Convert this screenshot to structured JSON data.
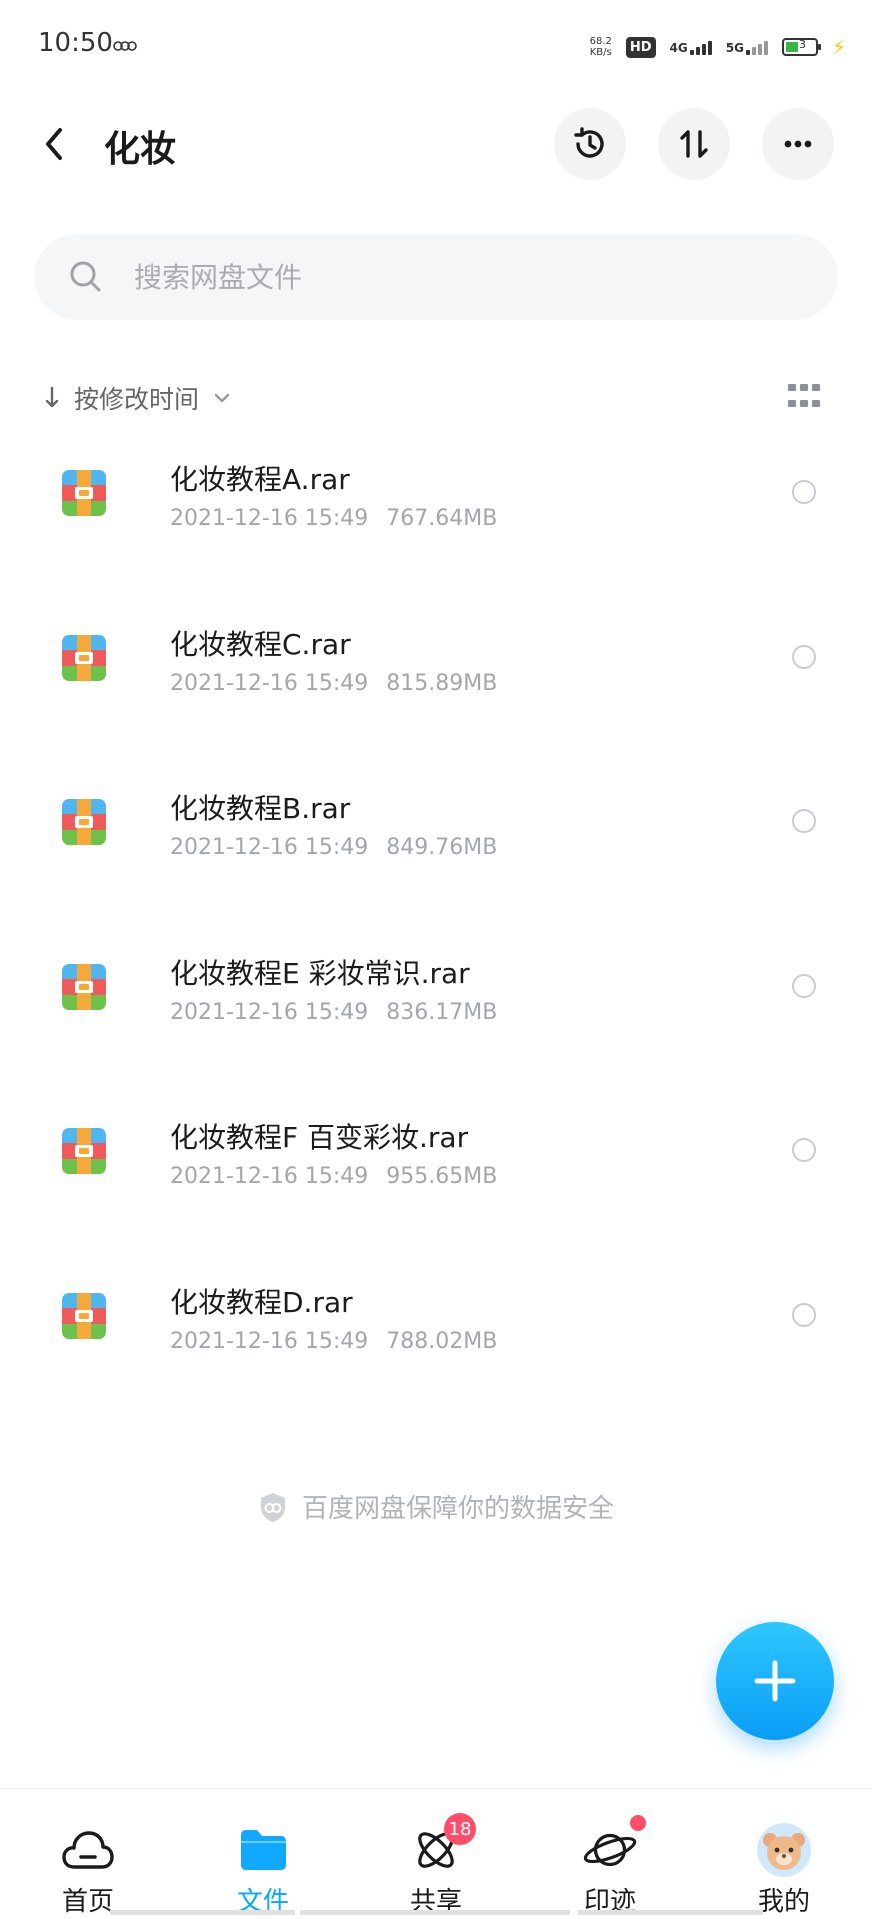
{
  "status_bar": {
    "time": "10:50",
    "net_speed_value": "68.2",
    "net_speed_unit": "KB/s",
    "hd_label": "HD",
    "sim1_label": "4G",
    "sim2_label": "5G",
    "battery_level": "3"
  },
  "header": {
    "title": "化妆",
    "history_icon": "history-icon",
    "sort_icon": "sort-arrows-icon",
    "more_icon": "more-icon"
  },
  "search": {
    "placeholder": "搜索网盘文件"
  },
  "sort_bar": {
    "label": "按修改时间"
  },
  "files": [
    {
      "name": "化妆教程A.rar",
      "date": "2021-12-16 15:49",
      "size": "767.64MB"
    },
    {
      "name": "化妆教程C.rar",
      "date": "2021-12-16 15:49",
      "size": "815.89MB"
    },
    {
      "name": "化妆教程B.rar",
      "date": "2021-12-16 15:49",
      "size": "849.76MB"
    },
    {
      "name": "化妆教程E 彩妆常识.rar",
      "date": "2021-12-16 15:49",
      "size": "836.17MB"
    },
    {
      "name": "化妆教程F 百变彩妆.rar",
      "date": "2021-12-16 15:49",
      "size": "955.65MB"
    },
    {
      "name": "化妆教程D.rar",
      "date": "2021-12-16 15:49",
      "size": "788.02MB"
    }
  ],
  "footer_note": "百度网盘保障你的数据安全",
  "nav": {
    "items": [
      {
        "label": "首页"
      },
      {
        "label": "文件"
      },
      {
        "label": "共享",
        "badge": "18"
      },
      {
        "label": "印迹"
      },
      {
        "label": "我的"
      }
    ]
  },
  "colors": {
    "accent": "#06a7ff",
    "badge": "#ff4d6a"
  }
}
